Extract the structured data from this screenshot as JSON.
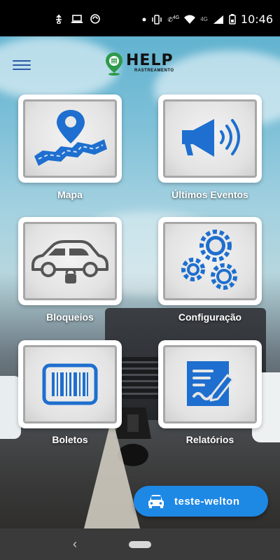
{
  "status_bar": {
    "time": "10:46",
    "network": "4G",
    "network2": "4G",
    "icons": [
      "usb-icon",
      "laptop-icon",
      "sync-icon",
      "dot-icon",
      "vibrate-icon",
      "wifi-calling-icon",
      "wifi-icon",
      "signal-icon",
      "battery-icon"
    ]
  },
  "header": {
    "menu_icon": "hamburger-menu-icon",
    "logo_title": "HELP",
    "logo_subtitle": "RASTREAMENTO",
    "logo_icon": "map-pin-logo-icon"
  },
  "tiles": [
    {
      "label": "Mapa",
      "icon": "map-route-icon"
    },
    {
      "label": "Últimos Eventos",
      "icon": "megaphone-icon"
    },
    {
      "label": "Bloqueios",
      "icon": "car-lock-icon"
    },
    {
      "label": "Configuração",
      "icon": "gears-icon"
    },
    {
      "label": "Boletos",
      "icon": "barcode-icon"
    },
    {
      "label": "Relatórios",
      "icon": "report-edit-icon"
    }
  ],
  "fab": {
    "label": "teste-welton",
    "icon": "car-icon"
  },
  "colors": {
    "accent": "#1e88e5",
    "icon_blue": "#1e6fcf",
    "logo_green": "#2e9a4b"
  },
  "nav": {
    "back_icon": "back-chevron-icon",
    "home_icon": "home-pill-icon"
  }
}
